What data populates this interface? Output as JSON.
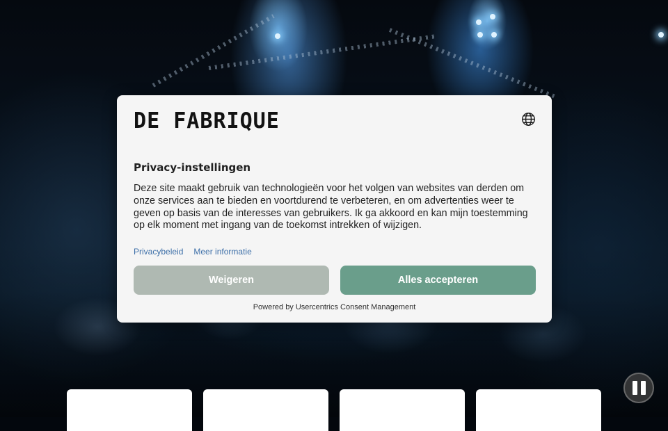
{
  "consent": {
    "brand": "DE FABRIQUE",
    "title": "Privacy-instellingen",
    "description": "Deze site maakt gebruik van technologieën voor het volgen van websites van derden om onze services aan te bieden en voortdurend te verbeteren, en om advertenties weer te geven op basis van de interesses van gebruikers. Ik ga akkoord en kan mijn toestemming op elk moment met ingang van de toekomst intrekken of wijzigen.",
    "links": {
      "privacy": "Privacybeleid",
      "more_info": "Meer informatie"
    },
    "buttons": {
      "deny": "Weigeren",
      "accept": "Alles accepteren"
    },
    "powered_by": "Powered by Usercentrics Consent Management",
    "language_icon": "globe-icon"
  },
  "media": {
    "pause_icon": "pause-icon"
  },
  "colors": {
    "accept": "#6a9e8b",
    "deny": "#afb9b2",
    "link": "#3d6fa8",
    "modal_bg": "#f5f5f5"
  }
}
